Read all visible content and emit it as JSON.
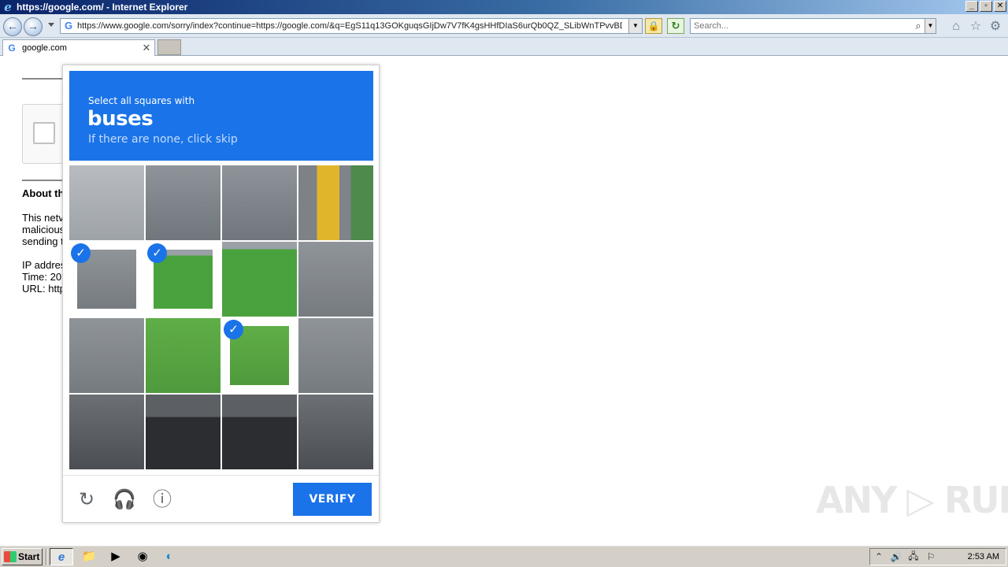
{
  "window": {
    "title": "https://google.com/ - Internet Explorer",
    "controls": [
      "_",
      "▫",
      "✕"
    ]
  },
  "address_bar": {
    "url": "https://www.google.com/sorry/index?continue=https://google.com/&q=EgS11q13GOKguqsGIjDw7V7fK4gsHHfDIaS6urQb0QZ_SLibWnTPvvBDwt",
    "search_placeholder": "Search..."
  },
  "tabs": [
    {
      "label": "google.com",
      "close": "✕"
    }
  ],
  "page": {
    "about_heading": "About th",
    "para_lines": [
      "This netv",
      "malicious",
      "sending t"
    ],
    "info_lines": [
      "IP addres",
      "Time: 20",
      "URL: http"
    ]
  },
  "captcha": {
    "instruction_small": "Select all squares with",
    "target_word": "buses",
    "hint": "If there are none, click skip",
    "verify_label": "VERIFY",
    "accent_color": "#1a73e8",
    "tiles": [
      {
        "id": 1,
        "scene": "sky",
        "selected": false
      },
      {
        "id": 2,
        "scene": "building",
        "selected": false
      },
      {
        "id": 3,
        "scene": "building",
        "selected": false
      },
      {
        "id": 4,
        "scene": "sign-y",
        "selected": false
      },
      {
        "id": 5,
        "scene": "street",
        "selected": true
      },
      {
        "id": 6,
        "scene": "bus-top",
        "selected": true
      },
      {
        "id": 7,
        "scene": "bus-top",
        "selected": false
      },
      {
        "id": 8,
        "scene": "street",
        "selected": false
      },
      {
        "id": 9,
        "scene": "street",
        "selected": false
      },
      {
        "id": 10,
        "scene": "bus",
        "selected": false
      },
      {
        "id": 11,
        "scene": "bus",
        "selected": true
      },
      {
        "id": 12,
        "scene": "street",
        "selected": false
      },
      {
        "id": 13,
        "scene": "road",
        "selected": false
      },
      {
        "id": 14,
        "scene": "wheel",
        "selected": false
      },
      {
        "id": 15,
        "scene": "wheel",
        "selected": false
      },
      {
        "id": 16,
        "scene": "road",
        "selected": false
      }
    ]
  },
  "watermark": "ANY ▷ RUN",
  "taskbar": {
    "start_label": "Start",
    "clock": "2:53 AM"
  }
}
